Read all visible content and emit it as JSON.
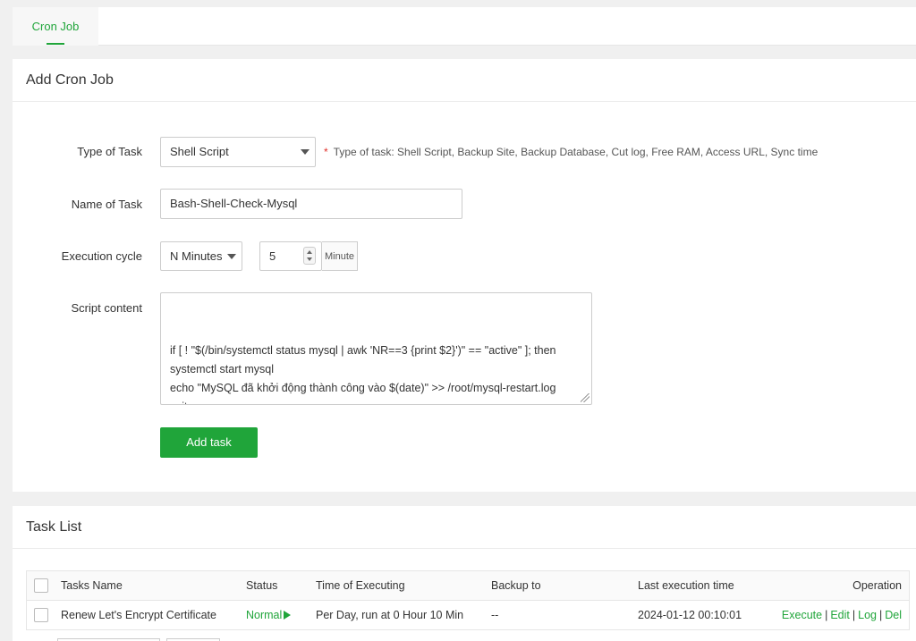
{
  "tabs": [
    {
      "label": "Cron Job",
      "active": true
    }
  ],
  "colors": {
    "accent": "#20a53a",
    "required": "#e0302a"
  },
  "add_form": {
    "title": "Add Cron Job",
    "type_of_task": {
      "label": "Type of Task",
      "value": "Shell Script",
      "hint_star": "*",
      "hint": "Type of task: Shell Script, Backup Site, Backup Database, Cut log, Free RAM, Access URL, Sync time"
    },
    "name_of_task": {
      "label": "Name of Task",
      "value": "Bash-Shell-Check-Mysql"
    },
    "execution_cycle": {
      "label": "Execution cycle",
      "cycle_value": "N Minutes",
      "number_value": "5",
      "unit": "Minute"
    },
    "script_content": {
      "label": "Script content",
      "value": "if [ ! \"$(/bin/systemctl status mysql | awk 'NR==3 {print $2}')\" == \"active\" ]; then\nsystemctl start mysql\necho \"MySQL đã khởi động thành công vào $(date)\" >> /root/mysql-restart.log\nexit\nfi"
    },
    "submit_label": "Add task"
  },
  "task_list": {
    "title": "Task List",
    "columns": [
      "Tasks Name",
      "Status",
      "Time of Executing",
      "Backup to",
      "Last execution time",
      "Operation"
    ],
    "rows": [
      {
        "name": "Renew Let's Encrypt Certificate",
        "status": "Normal",
        "time_of_executing": "Per Day, run at 0 Hour 10 Min",
        "backup_to": "--",
        "last_execution_time": "2024-01-12 00:10:01",
        "operations": [
          "Execute",
          "Edit",
          "Log",
          "Del"
        ],
        "separator": "|"
      }
    ]
  }
}
